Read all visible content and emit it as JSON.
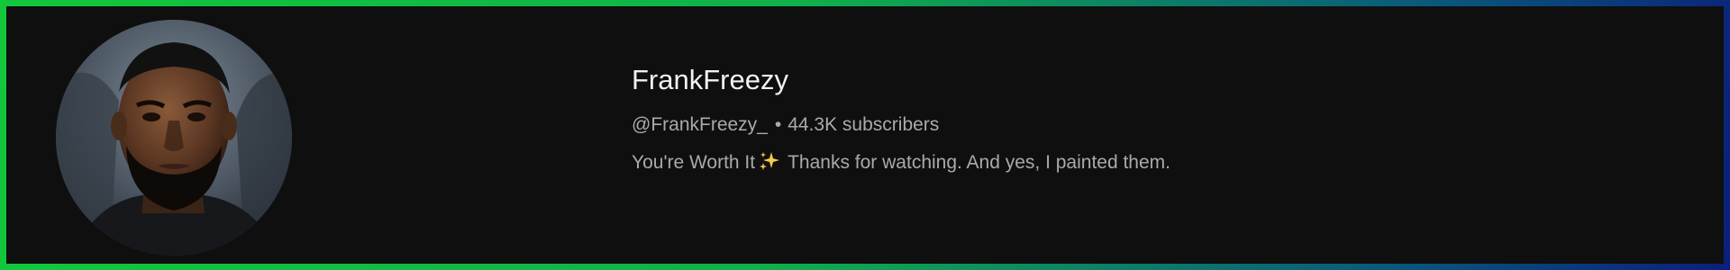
{
  "channel": {
    "name": "FrankFreezy",
    "handle": "@FrankFreezy_",
    "separator": "•",
    "subscribers": "44.3K subscribers",
    "description_part1": "You're Worth It",
    "description_icon": "sparkles-icon",
    "description_part2": "Thanks for watching. And yes, I painted them.",
    "avatar_icon": "channel-avatar-portrait"
  },
  "colors": {
    "background": "#0f0f0f",
    "title_text": "#f1f1f1",
    "secondary_text": "#aaaaaa",
    "border_gradient_start": "#12c83a",
    "border_gradient_end": "#0b1f7a",
    "sparkle": "#f7c948"
  }
}
